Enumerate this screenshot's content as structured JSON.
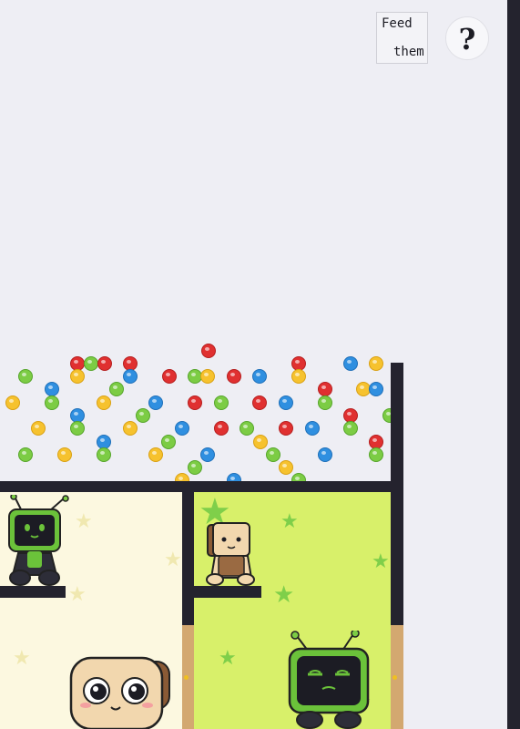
{
  "feed_button": {
    "line1": "Feed",
    "line2": "them"
  },
  "help_button": {
    "label": "?"
  },
  "colors": {
    "background": "#eeeef4",
    "wall": "#24232e",
    "room_yellow": "#fcf8e0",
    "room_green": "#d8f06a",
    "door": "#d3a870",
    "ball_red": "#e03030",
    "ball_green": "#7ccc44",
    "ball_blue": "#2f8fe0",
    "ball_yellow": "#f6c22e"
  },
  "balls": {
    "total": 69,
    "colors": [
      "red",
      "green",
      "blue",
      "yellow"
    ]
  },
  "rooms": [
    {
      "name": "yellow-room",
      "characters": [
        "tv-head-creature",
        "toast-creature"
      ]
    },
    {
      "name": "green-room",
      "characters": [
        "box-head-creature",
        "green-tv-creature"
      ]
    }
  ]
}
